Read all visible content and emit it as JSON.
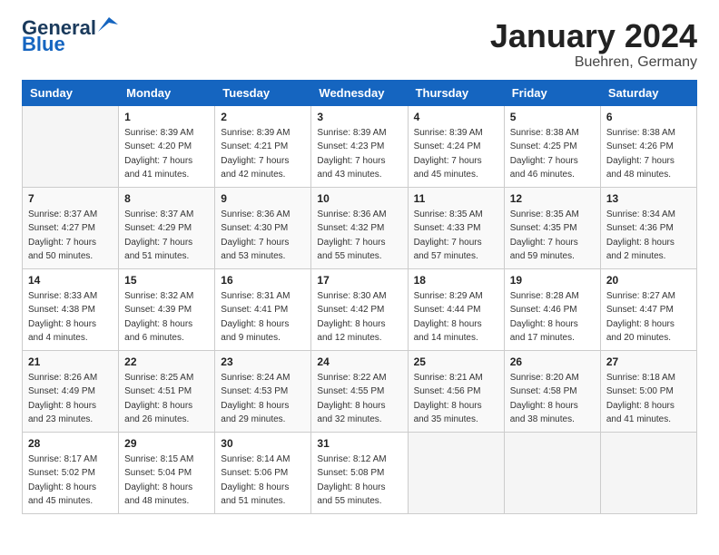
{
  "header": {
    "logo_line1": "General",
    "logo_line2": "Blue",
    "month": "January 2024",
    "location": "Buehren, Germany"
  },
  "weekdays": [
    "Sunday",
    "Monday",
    "Tuesday",
    "Wednesday",
    "Thursday",
    "Friday",
    "Saturday"
  ],
  "weeks": [
    [
      {
        "day": "",
        "info": ""
      },
      {
        "day": "1",
        "info": "Sunrise: 8:39 AM\nSunset: 4:20 PM\nDaylight: 7 hours\nand 41 minutes."
      },
      {
        "day": "2",
        "info": "Sunrise: 8:39 AM\nSunset: 4:21 PM\nDaylight: 7 hours\nand 42 minutes."
      },
      {
        "day": "3",
        "info": "Sunrise: 8:39 AM\nSunset: 4:23 PM\nDaylight: 7 hours\nand 43 minutes."
      },
      {
        "day": "4",
        "info": "Sunrise: 8:39 AM\nSunset: 4:24 PM\nDaylight: 7 hours\nand 45 minutes."
      },
      {
        "day": "5",
        "info": "Sunrise: 8:38 AM\nSunset: 4:25 PM\nDaylight: 7 hours\nand 46 minutes."
      },
      {
        "day": "6",
        "info": "Sunrise: 8:38 AM\nSunset: 4:26 PM\nDaylight: 7 hours\nand 48 minutes."
      }
    ],
    [
      {
        "day": "7",
        "info": "Sunrise: 8:37 AM\nSunset: 4:27 PM\nDaylight: 7 hours\nand 50 minutes."
      },
      {
        "day": "8",
        "info": "Sunrise: 8:37 AM\nSunset: 4:29 PM\nDaylight: 7 hours\nand 51 minutes."
      },
      {
        "day": "9",
        "info": "Sunrise: 8:36 AM\nSunset: 4:30 PM\nDaylight: 7 hours\nand 53 minutes."
      },
      {
        "day": "10",
        "info": "Sunrise: 8:36 AM\nSunset: 4:32 PM\nDaylight: 7 hours\nand 55 minutes."
      },
      {
        "day": "11",
        "info": "Sunrise: 8:35 AM\nSunset: 4:33 PM\nDaylight: 7 hours\nand 57 minutes."
      },
      {
        "day": "12",
        "info": "Sunrise: 8:35 AM\nSunset: 4:35 PM\nDaylight: 7 hours\nand 59 minutes."
      },
      {
        "day": "13",
        "info": "Sunrise: 8:34 AM\nSunset: 4:36 PM\nDaylight: 8 hours\nand 2 minutes."
      }
    ],
    [
      {
        "day": "14",
        "info": "Sunrise: 8:33 AM\nSunset: 4:38 PM\nDaylight: 8 hours\nand 4 minutes."
      },
      {
        "day": "15",
        "info": "Sunrise: 8:32 AM\nSunset: 4:39 PM\nDaylight: 8 hours\nand 6 minutes."
      },
      {
        "day": "16",
        "info": "Sunrise: 8:31 AM\nSunset: 4:41 PM\nDaylight: 8 hours\nand 9 minutes."
      },
      {
        "day": "17",
        "info": "Sunrise: 8:30 AM\nSunset: 4:42 PM\nDaylight: 8 hours\nand 12 minutes."
      },
      {
        "day": "18",
        "info": "Sunrise: 8:29 AM\nSunset: 4:44 PM\nDaylight: 8 hours\nand 14 minutes."
      },
      {
        "day": "19",
        "info": "Sunrise: 8:28 AM\nSunset: 4:46 PM\nDaylight: 8 hours\nand 17 minutes."
      },
      {
        "day": "20",
        "info": "Sunrise: 8:27 AM\nSunset: 4:47 PM\nDaylight: 8 hours\nand 20 minutes."
      }
    ],
    [
      {
        "day": "21",
        "info": "Sunrise: 8:26 AM\nSunset: 4:49 PM\nDaylight: 8 hours\nand 23 minutes."
      },
      {
        "day": "22",
        "info": "Sunrise: 8:25 AM\nSunset: 4:51 PM\nDaylight: 8 hours\nand 26 minutes."
      },
      {
        "day": "23",
        "info": "Sunrise: 8:24 AM\nSunset: 4:53 PM\nDaylight: 8 hours\nand 29 minutes."
      },
      {
        "day": "24",
        "info": "Sunrise: 8:22 AM\nSunset: 4:55 PM\nDaylight: 8 hours\nand 32 minutes."
      },
      {
        "day": "25",
        "info": "Sunrise: 8:21 AM\nSunset: 4:56 PM\nDaylight: 8 hours\nand 35 minutes."
      },
      {
        "day": "26",
        "info": "Sunrise: 8:20 AM\nSunset: 4:58 PM\nDaylight: 8 hours\nand 38 minutes."
      },
      {
        "day": "27",
        "info": "Sunrise: 8:18 AM\nSunset: 5:00 PM\nDaylight: 8 hours\nand 41 minutes."
      }
    ],
    [
      {
        "day": "28",
        "info": "Sunrise: 8:17 AM\nSunset: 5:02 PM\nDaylight: 8 hours\nand 45 minutes."
      },
      {
        "day": "29",
        "info": "Sunrise: 8:15 AM\nSunset: 5:04 PM\nDaylight: 8 hours\nand 48 minutes."
      },
      {
        "day": "30",
        "info": "Sunrise: 8:14 AM\nSunset: 5:06 PM\nDaylight: 8 hours\nand 51 minutes."
      },
      {
        "day": "31",
        "info": "Sunrise: 8:12 AM\nSunset: 5:08 PM\nDaylight: 8 hours\nand 55 minutes."
      },
      {
        "day": "",
        "info": ""
      },
      {
        "day": "",
        "info": ""
      },
      {
        "day": "",
        "info": ""
      }
    ]
  ]
}
